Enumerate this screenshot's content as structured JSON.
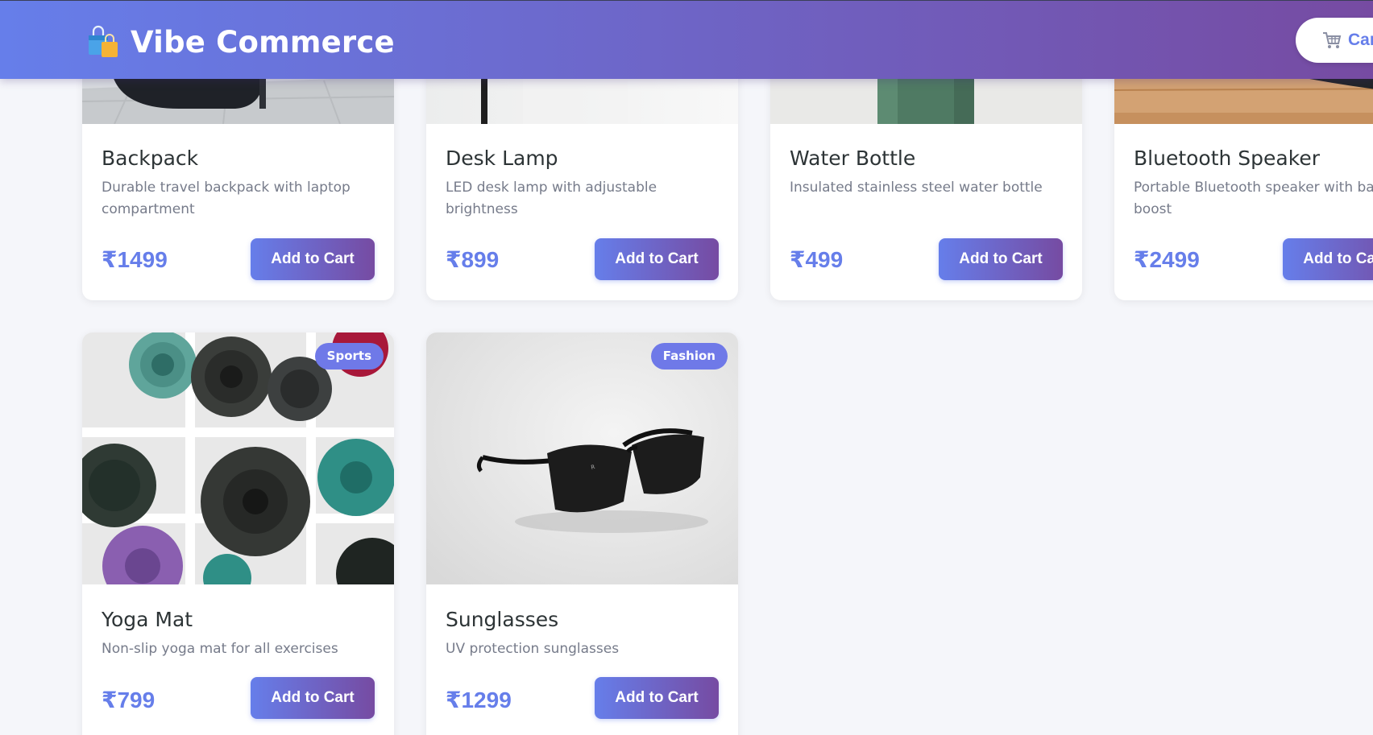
{
  "header": {
    "title": "Vibe Commerce",
    "cart_label": "Cart",
    "logo_icon": "shopping-bags-icon",
    "cart_icon": "cart-icon"
  },
  "products_top_row": [
    {
      "name": "Backpack",
      "description": "Durable travel backpack with laptop compartment",
      "price": "₹1499",
      "button": "Add to Cart"
    },
    {
      "name": "Desk Lamp",
      "description": "LED desk lamp with adjustable brightness",
      "price": "₹899",
      "button": "Add to Cart"
    },
    {
      "name": "Water Bottle",
      "description": "Insulated stainless steel water bottle",
      "price": "₹499",
      "button": "Add to Cart"
    },
    {
      "name": "Bluetooth Speaker",
      "description": "Portable Bluetooth speaker with bass boost",
      "price": "₹2499",
      "button": "Add to Cart"
    }
  ],
  "products_bottom_row": [
    {
      "name": "Yoga Mat",
      "category": "Sports",
      "description": "Non-slip yoga mat for all exercises",
      "price": "₹799",
      "button": "Add to Cart"
    },
    {
      "name": "Sunglasses",
      "category": "Fashion",
      "description": "UV protection sunglasses",
      "price": "₹1299",
      "button": "Add to Cart"
    }
  ],
  "colors": {
    "accent": "#667eea",
    "accent_end": "#764ba2",
    "background": "#f5f6fa",
    "badge": "#6f79e8"
  }
}
